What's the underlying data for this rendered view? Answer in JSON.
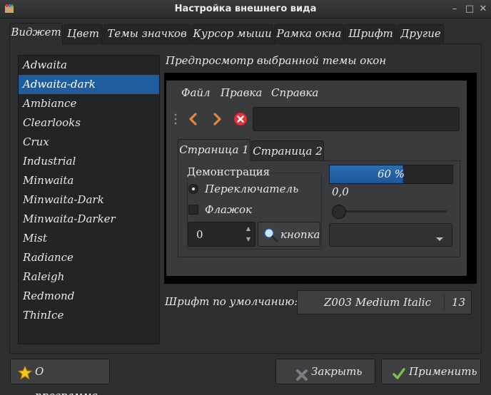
{
  "window": {
    "title": "Настройка внешнего вида",
    "controls": [
      "–",
      "□",
      "✕"
    ]
  },
  "tabs": [
    {
      "label": "Виджет",
      "active": true
    },
    {
      "label": "Цвет"
    },
    {
      "label": "Темы значков"
    },
    {
      "label": "Курсор мыши"
    },
    {
      "label": "Рамка окна"
    },
    {
      "label": "Шрифт"
    },
    {
      "label": "Другие"
    }
  ],
  "themes": {
    "selected": "Adwaita-dark",
    "items": [
      "Adwaita",
      "Adwaita-dark",
      "Ambiance",
      "Clearlooks",
      "Crux",
      "Industrial",
      "Minwaita",
      "Minwaita-Dark",
      "Minwaita-Darker",
      "Mist",
      "Radiance",
      "Raleigh",
      "Redmond",
      "ThinIce"
    ]
  },
  "preview": {
    "title": "Предпросмотр выбранной темы окон",
    "menu": [
      "Файл",
      "Правка",
      "Справка"
    ],
    "pages": [
      "Страница 1",
      "Страница 2"
    ],
    "demo_frame_label": "Демонстрация",
    "radio_label": "Переключатель",
    "checkbox_label": "Флажок",
    "spin_value": "0",
    "button_label": "кнопка",
    "progress_text": "60 %",
    "progress_value": 0.6,
    "scale_value": "0,0"
  },
  "font": {
    "label": "Шрифт по умолчанию:",
    "name": "Z003 Medium Italic",
    "size": "13"
  },
  "buttons": {
    "about": "О программе",
    "close": "Закрыть",
    "apply": "Применить"
  },
  "colors": {
    "selection": "#215d9c",
    "window_bg": "#2e2f30",
    "toolbar_arrow": "#e8843c",
    "stop_icon": "#e0333a",
    "apply_check": "#7bc244",
    "about_star": "#f5c518"
  }
}
